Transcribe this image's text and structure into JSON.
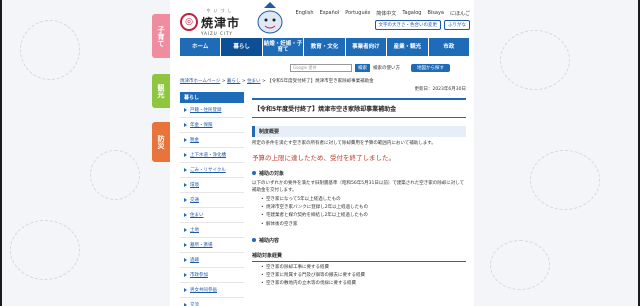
{
  "side_tabs": [
    {
      "label": "子育て",
      "color": "#f08ca0"
    },
    {
      "label": "観光",
      "color": "#8ec63f"
    },
    {
      "label": "防災",
      "color": "#e8743b"
    }
  ],
  "header": {
    "logo_ruby": "やいづし",
    "logo_name": "焼津市",
    "logo_en": "YAIZU CITY",
    "languages": [
      "English",
      "Español",
      "Português",
      "简体中文",
      "Tagalog",
      "Bisaya",
      "にほんご"
    ],
    "util_buttons": [
      "文字の大きさ・色合いの変更",
      "ふりがな"
    ]
  },
  "gnav": [
    "ホーム",
    "暮らし",
    "結婚・妊娠・子育て",
    "教育・文化",
    "事業者向け",
    "産業・観光",
    "市政"
  ],
  "gnav_active": 1,
  "search": {
    "placeholder": "Google 提供",
    "button": "検索",
    "help": "検索の使い方",
    "map_button": "地図から探す"
  },
  "breadcrumb": {
    "items": [
      "焼津市ホームページ",
      "暮らし",
      "住まい"
    ],
    "current": "【令和5年度受付終了】焼津市空き家除却事業補助金"
  },
  "sidebar": {
    "heading": "暮らし",
    "items": [
      "戸籍・住民登録",
      "年金・保険",
      "税金",
      "上下水道・浄化槽",
      "ごみ・リサイクル",
      "環境",
      "交通",
      "住まい",
      "土地",
      "墓所・斎場",
      "過疎",
      "市政参加",
      "男女共同参画",
      "交流"
    ]
  },
  "content": {
    "updated": "更新日：2023年6月30日",
    "title": "【令和5年度受付終了】焼津市空き家除却事業補助金",
    "section1": "制度概要",
    "para1": "所定の条件を満たす空き家の所有者に対して除却費用を予算の範囲内において補助します。",
    "warning": "予算の上限に達したため、受付を終了しました。",
    "section2": "補助の対象",
    "para2": "以下のいずれかの要件を満たす旧耐震基準（昭和56年5月31日以前）で建築された空き家の除却に対して補助金を交付します。",
    "bullets": [
      "空き家になって5年以上経過したもの",
      "焼津市空き家バンクに登録し2年以上経過したもの",
      "宅建業者と媒介契約を締結し2年以上経過したもの",
      "解体後の空き家"
    ],
    "section3": "補助内容",
    "section4": "補助対象経費",
    "bullets2": [
      "空き家の除却工事に要する経費",
      "空き家に附属する門及び塀等の撤去に要する経費",
      "空き家の敷地内の立木等の伐採に要する経費"
    ]
  }
}
